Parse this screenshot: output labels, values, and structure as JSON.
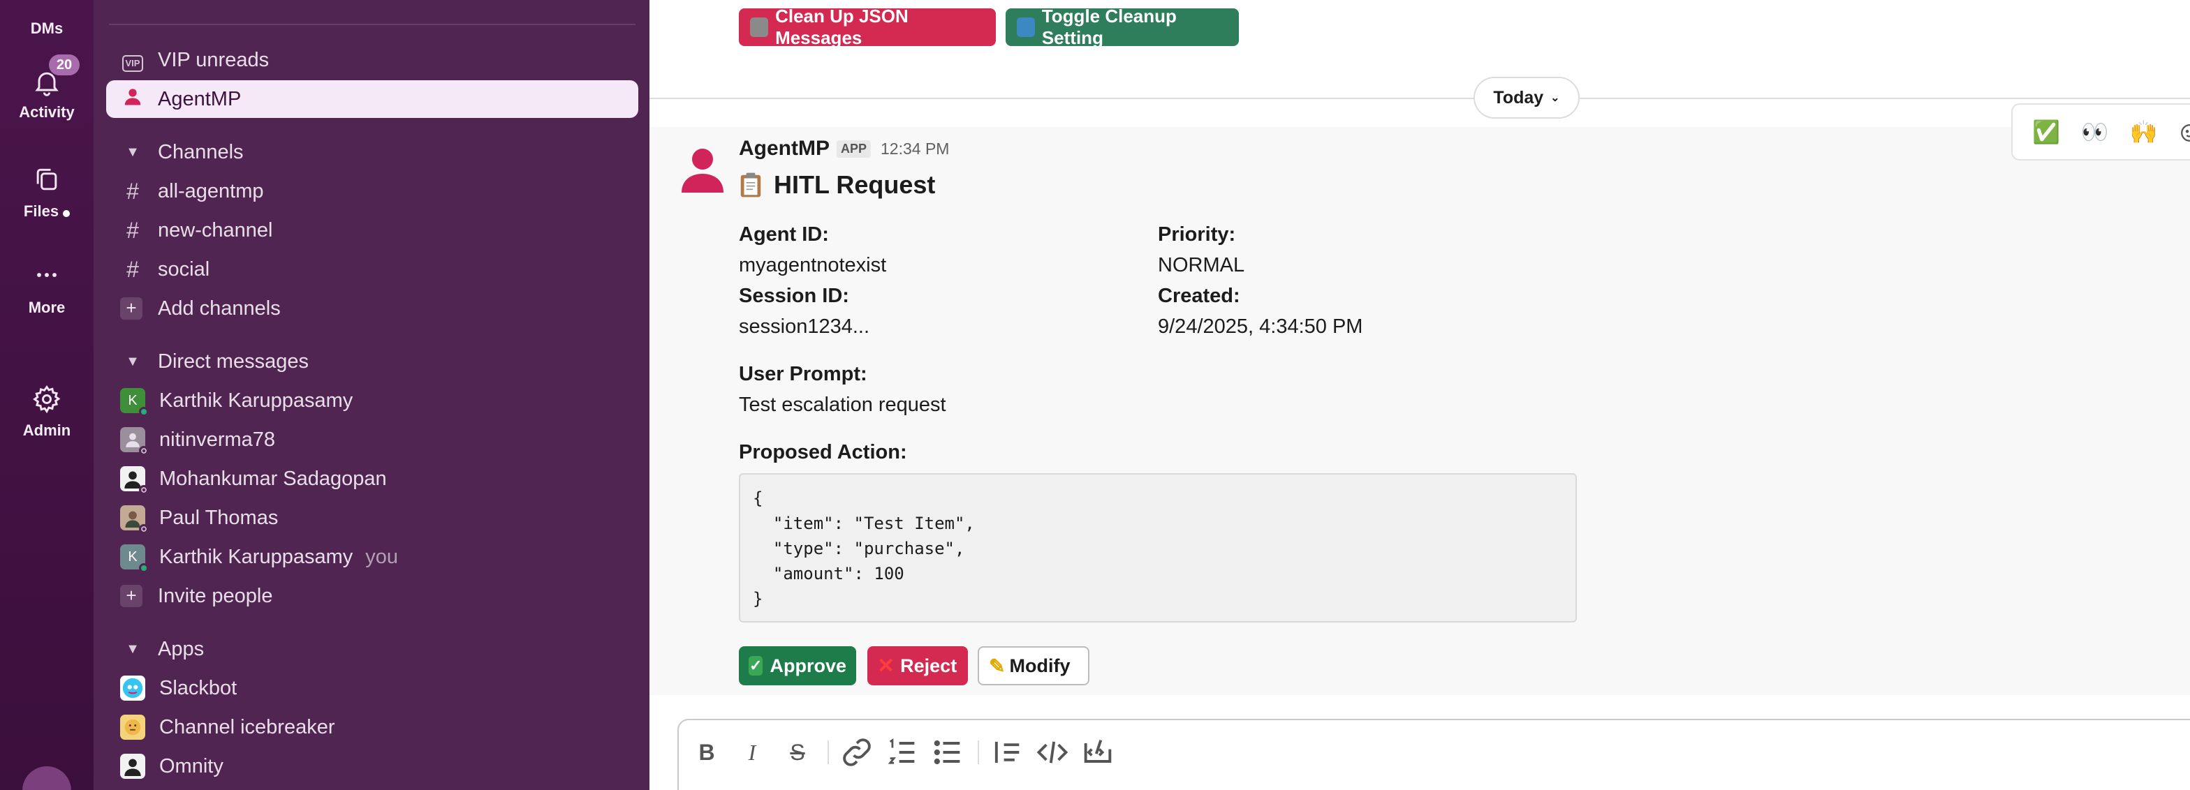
{
  "rail": {
    "dms_label": "DMs",
    "activity_label": "Activity",
    "activity_badge": "20",
    "files_label": "Files",
    "more_label": "More",
    "admin_label": "Admin"
  },
  "sidebar": {
    "vip_label": "VIP unreads",
    "vip_icon_text": "VIP",
    "active_item": "AgentMP",
    "channels_header": "Channels",
    "channels": [
      "all-agentmp",
      "new-channel",
      "social"
    ],
    "add_channels": "Add channels",
    "dm_header": "Direct messages",
    "dms": [
      {
        "name": "Karthik Karuppasamy",
        "initial": "K"
      },
      {
        "name": "nitinverma78",
        "initial": ""
      },
      {
        "name": "Mohankumar Sadagopan",
        "initial": ""
      },
      {
        "name": "Paul Thomas",
        "initial": ""
      },
      {
        "name": "Karthik Karuppasamy",
        "initial": "K",
        "suffix": "you"
      }
    ],
    "invite_people": "Invite people",
    "apps_header": "Apps",
    "apps": [
      "Slackbot",
      "Channel icebreaker",
      "Omnity"
    ]
  },
  "main": {
    "cleanup_button": "Clean Up JSON Messages",
    "toggle_button": "Toggle Cleanup Setting",
    "date_divider": "Today",
    "message": {
      "sender": "AgentMP",
      "app_tag": "APP",
      "time": "12:34 PM",
      "title": "HITL Request",
      "agent_id_label": "Agent ID:",
      "agent_id": "myagentnotexist",
      "priority_label": "Priority:",
      "priority": "NORMAL",
      "session_id_label": "Session ID:",
      "session_id": "session1234...",
      "created_label": "Created:",
      "created": "9/24/2025, 4:34:50 PM",
      "user_prompt_label": "User Prompt:",
      "user_prompt": "Test escalation request",
      "proposed_action_label": "Proposed Action:",
      "proposed_action_code": "{\n  \"item\": \"Test Item\",\n  \"type\": \"purchase\",\n  \"amount\": 100\n}",
      "approve_label": "Approve",
      "reject_label": "Reject",
      "modify_label": "Modify"
    },
    "reactions": [
      "✅",
      "👀",
      "🙌"
    ]
  },
  "colors": {
    "rail_bg": "#3f0e40",
    "sidebar_bg": "#512552",
    "active_item_bg": "#f6e9f7",
    "danger": "#e01e5a",
    "success": "#2e7d5b",
    "approve": "#1e7b4a"
  }
}
